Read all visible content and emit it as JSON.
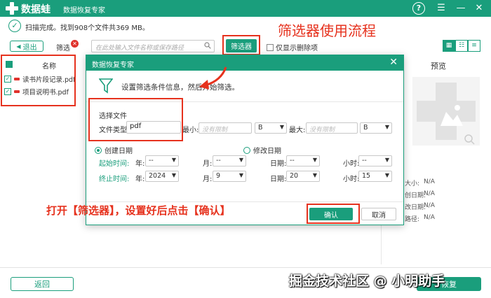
{
  "titlebar": {
    "brand": "数据蛙",
    "subtitle": "数据恢复专家",
    "help_icon": "?",
    "menu_icon": "☰",
    "minimize_icon": "—",
    "close_icon": "✕"
  },
  "status": {
    "check": "✓",
    "text": "扫描完成。找到908个文件共369 MB。"
  },
  "toolbar": {
    "back_label": "退出",
    "filter_label": "筛选",
    "filter_clear": "✕",
    "search_placeholder": "在此处输入文件名称或保存路径",
    "filter_button": "筛选器",
    "show_deleted": "仅显示删除项",
    "view_grid": "▦",
    "view_list": "☷",
    "view_detail": "≡"
  },
  "file_list": {
    "header": "名称",
    "items": [
      {
        "name": "读书片段记录.pdf"
      },
      {
        "name": "项目说明书.pdf"
      }
    ]
  },
  "preview": {
    "title": "预览",
    "meta": [
      {
        "label": "大小:",
        "value": "N/A"
      },
      {
        "label": "创日期:",
        "value": "N/A"
      },
      {
        "label": "改日期:",
        "value": "N/A"
      },
      {
        "label": "路径:",
        "value": "N/A"
      }
    ]
  },
  "modal": {
    "title": "数据恢复专家",
    "close": "✕",
    "instruction": "设置筛选条件信息，然后开始筛选。",
    "section_title": "选择文件",
    "file_type_label": "文件类型:",
    "file_type_value": "pdf",
    "min_label": "最小:",
    "min_placeholder": "没有限制",
    "min_unit": "B",
    "max_label": "最大:",
    "max_placeholder": "没有限制",
    "max_unit": "B",
    "radio_created": "创建日期",
    "radio_modified": "修改日期",
    "start_label": "起始时间:",
    "end_label": "终止时间:",
    "year_label": "年:",
    "month_label": "月:",
    "day_label": "日期:",
    "hour_label": "小时:",
    "start": {
      "year": "--",
      "month": "--",
      "day": "--",
      "hour": "--"
    },
    "end": {
      "year": "2024",
      "month": "9",
      "day": "20",
      "hour": "15"
    },
    "ok": "确认",
    "cancel": "取消"
  },
  "annotations": {
    "flow_title": "筛选器使用流程",
    "instruction_note": "打开【筛选器】，设置好后点击【确认】"
  },
  "bottom": {
    "back": "返回",
    "recover": "恢复",
    "watermark": "掘金技术社区 @ 小明助手"
  },
  "colors": {
    "accent": "#1a9e7c",
    "annotation": "#e6321e"
  }
}
